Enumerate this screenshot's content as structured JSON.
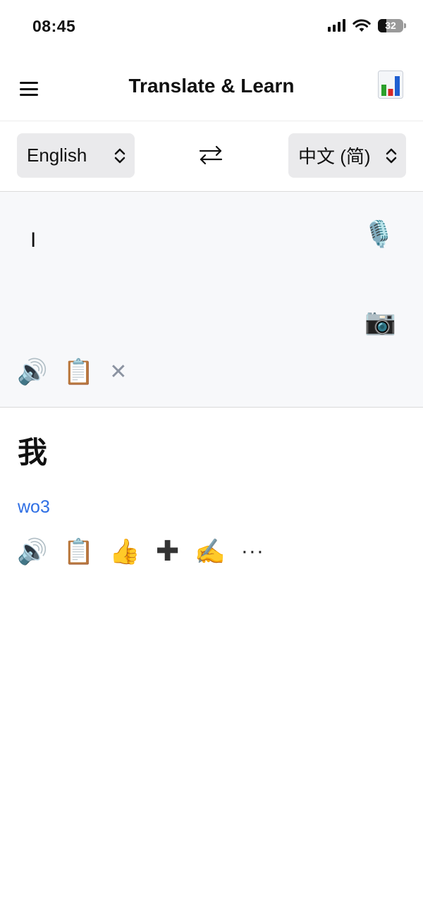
{
  "status_bar": {
    "time": "08:45",
    "battery_level": "32",
    "icons": [
      "signal-icon",
      "wifi-icon",
      "battery-icon"
    ]
  },
  "header": {
    "title": "Translate & Learn",
    "menu_icon": "hamburger-menu-icon",
    "stats_icon": "bar-chart-icon"
  },
  "languages": {
    "source": "English",
    "target": "中文 (简)",
    "swap_icon": "swap-arrows-icon"
  },
  "input": {
    "text": "I",
    "mic_glyph": "🎙️",
    "camera_glyph": "📷",
    "speaker_glyph": "🔊",
    "clipboard_glyph": "📋",
    "clear_glyph": "✕"
  },
  "output": {
    "translation": "我",
    "pinyin": "wo3",
    "speaker_glyph": "🔊",
    "clipboard_glyph": "📋",
    "thumbs_up_glyph": "👍",
    "plus_glyph": "✚",
    "handwriting_glyph": "✍️",
    "more_glyph": "···"
  },
  "colors": {
    "pinyin": "#2f6fe4",
    "input_background": "#f7f8fa",
    "select_background": "#eaeaec"
  }
}
